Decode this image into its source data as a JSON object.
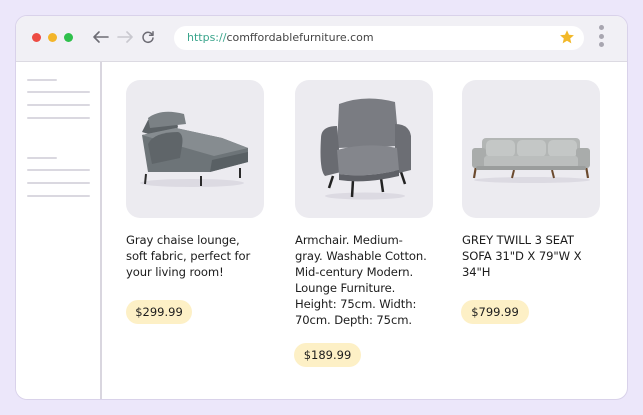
{
  "browser": {
    "url_scheme": "https://",
    "url_host": "comffordablefurniture.com",
    "traffic_lights": {
      "close": "#ed4b43",
      "minimize": "#f3b52a",
      "zoom": "#2fc04c"
    },
    "icons": [
      "back-arrow-icon",
      "forward-arrow-icon",
      "reload-icon",
      "star-icon",
      "more-options-icon"
    ]
  },
  "colors": {
    "price_badge": "#fdf0c6",
    "background": "#ece7fa",
    "star": "#f2b829"
  },
  "products": [
    {
      "description": "Gray chaise lounge, soft fabric, perfect for your living room!",
      "lines": [
        "Gray chaise lounge,",
        "soft fabric, perfect for",
        "your living room!"
      ],
      "price": "$299.99"
    },
    {
      "description": "Armchair. Medium-gray. Washable Cotton. Mid-century Modern. Lounge Furniture. Height: 75cm. Width: 70cm. Depth: 75cm.",
      "lines": [
        "Armchair. Medium-",
        "gray. Washable Cotton.",
        "Mid-century Modern.",
        "Lounge Furniture.",
        "Height: 75cm. Width:",
        "70cm. Depth: 75cm."
      ],
      "price": "$189.99"
    },
    {
      "description": "GREY TWILL 3 SEAT SOFA 31\"D X 79\"W X 34\"H",
      "lines": [
        "GREY TWILL 3 SEAT",
        "SOFA 31\"D X 79\"W X",
        "34\"H"
      ],
      "price": "$799.99"
    }
  ]
}
